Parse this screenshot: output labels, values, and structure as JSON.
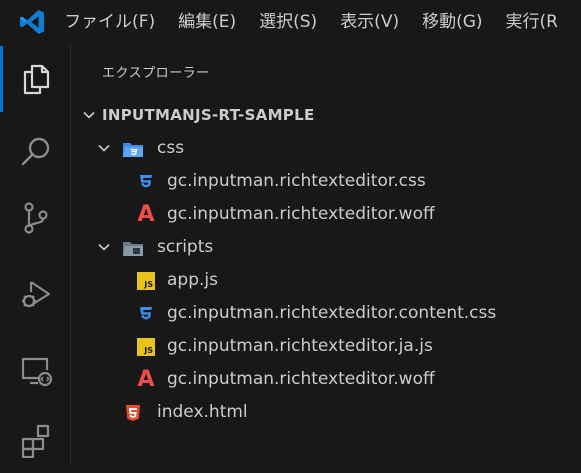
{
  "menu": {
    "items": [
      {
        "label": "ファイル(F)"
      },
      {
        "label": "編集(E)"
      },
      {
        "label": "選択(S)"
      },
      {
        "label": "表示(V)"
      },
      {
        "label": "移動(G)"
      },
      {
        "label": "実行(R"
      }
    ]
  },
  "activitybar": {
    "items": [
      {
        "icon": "explorer-icon",
        "active": true
      },
      {
        "icon": "search-icon"
      },
      {
        "icon": "source-control-icon"
      },
      {
        "icon": "run-debug-icon"
      },
      {
        "icon": "remote-explorer-icon"
      },
      {
        "icon": "extensions-icon"
      }
    ]
  },
  "sidebar": {
    "title": "エクスプローラー",
    "root": {
      "label": "INPUTMANJS-RT-SAMPLE",
      "expanded": true
    },
    "tree": [
      {
        "label": "css",
        "type": "folder",
        "icon": "css-folder-icon",
        "expanded": true
      },
      {
        "label": "gc.inputman.richtexteditor.css",
        "type": "file",
        "icon": "css-file-icon"
      },
      {
        "label": "gc.inputman.richtexteditor.woff",
        "type": "file",
        "icon": "font-file-icon"
      },
      {
        "label": "scripts",
        "type": "folder",
        "icon": "scripts-folder-icon",
        "expanded": true
      },
      {
        "label": "app.js",
        "type": "file",
        "icon": "js-file-icon"
      },
      {
        "label": "gc.inputman.richtexteditor.content.css",
        "type": "file",
        "icon": "css-file-icon"
      },
      {
        "label": "gc.inputman.richtexteditor.ja.js",
        "type": "file",
        "icon": "js-file-icon"
      },
      {
        "label": "gc.inputman.richtexteditor.woff",
        "type": "file",
        "icon": "font-file-icon"
      },
      {
        "label": "index.html",
        "type": "file",
        "icon": "html-file-icon"
      }
    ]
  },
  "colors": {
    "background": "#181818",
    "text": "#cccccc",
    "accent": "#0078d4",
    "css_icon": "#3d8eea",
    "js_icon": "#e8c31a",
    "font_icon": "#f14c4c",
    "html_icon": "#e44d26"
  },
  "glyphs": {
    "js_badge": "JS",
    "font_glyph": "A"
  }
}
